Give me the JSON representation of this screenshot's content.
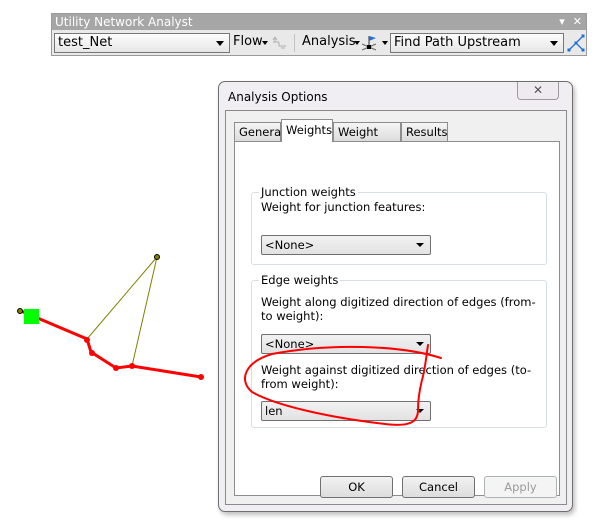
{
  "toolbar": {
    "title": "Utility Network Analyst",
    "title_buttons": [
      "▾",
      "✕"
    ],
    "network_combo_value": "test_Net",
    "flow_label": "Flow",
    "analysis_label": "Analysis",
    "task_combo_value": "Find Path Upstream",
    "icons": {
      "flow_dropdown": "chevron-down-icon",
      "flow_direction": "flow-direction-icon",
      "analysis_dropdown": "chevron-down-icon",
      "flag_tool": "flag-tool-icon",
      "solve": "solve-icon"
    }
  },
  "dialog": {
    "title": "Analysis Options",
    "close_glyph": "✕",
    "tabs": [
      {
        "label": "General",
        "active": false
      },
      {
        "label": "Weights",
        "active": true
      },
      {
        "label": "Weight Filter",
        "active": false
      },
      {
        "label": "Results",
        "active": false
      }
    ],
    "junction_group": {
      "legend": "Junction weights",
      "label": "Weight for junction features:",
      "value": "<None>"
    },
    "edge_group": {
      "legend": "Edge weights",
      "from_to_label": "Weight along digitized direction of edges (from-to weight):",
      "from_to_value": "<None>",
      "to_from_label": "Weight against digitized direction of edges (to-from weight):",
      "to_from_value": "len"
    },
    "buttons": {
      "ok": "OK",
      "cancel": "Cancel",
      "apply": "Apply"
    }
  },
  "map": {
    "colors": {
      "result_edge": "#ff0000",
      "network_edge": "#808000",
      "flag": "#00ff00"
    }
  },
  "annotation": {
    "color": "#ff0000",
    "description": "hand-drawn red circle around to-from weight dropdown"
  }
}
